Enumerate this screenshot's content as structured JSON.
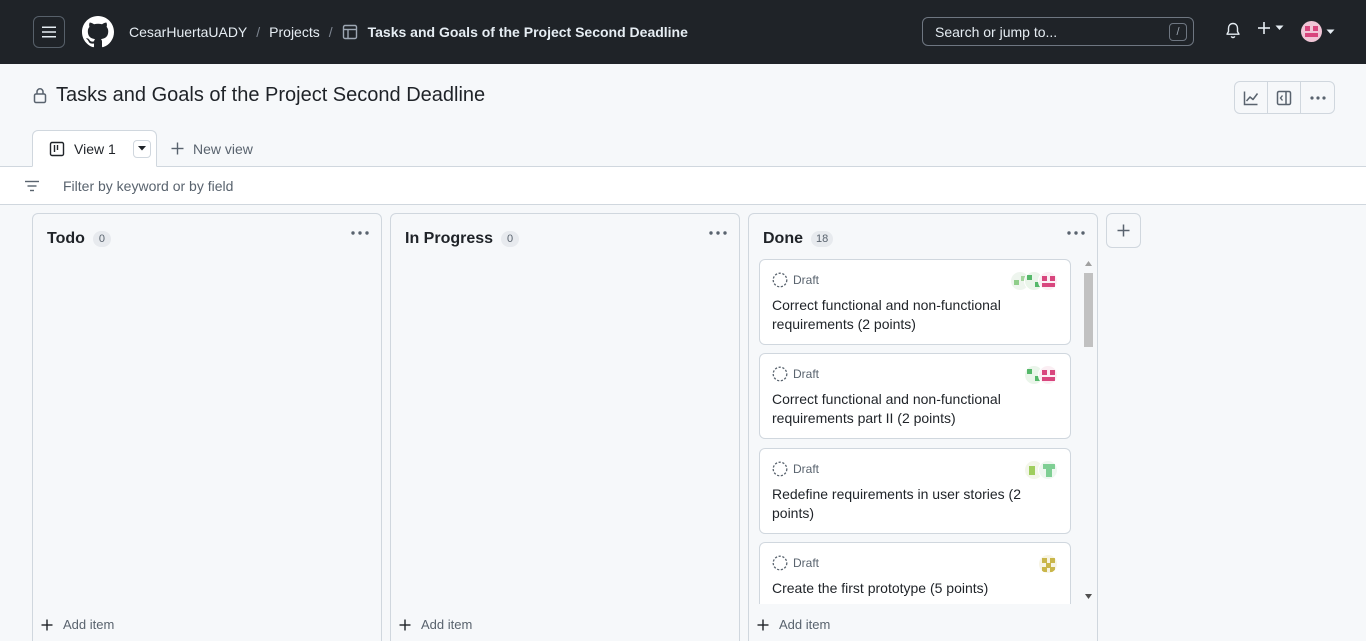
{
  "header": {
    "owner": "CesarHuertaUADY",
    "projects": "Projects",
    "project_name": "Tasks and Goals of the Project Second Deadline",
    "search_placeholder": "Search or jump to...",
    "search_shortcut": "/"
  },
  "project": {
    "title": "Tasks and Goals of the Project Second Deadline",
    "view_tab": "View 1",
    "new_view": "New view",
    "filter_placeholder": "Filter by keyword or by field"
  },
  "columns": [
    {
      "title": "Todo",
      "count": "0",
      "add_item": "Add item"
    },
    {
      "title": "In Progress",
      "count": "0",
      "add_item": "Add item"
    },
    {
      "title": "Done",
      "count": "18",
      "add_item": "Add item"
    }
  ],
  "cards": [
    {
      "status": "Draft",
      "title": "Correct functional and non-functional requirements (2 points)"
    },
    {
      "status": "Draft",
      "title": "Correct functional and non-functional requirements part II (2 points)"
    },
    {
      "status": "Draft",
      "title": "Redefine requirements in user stories (2 points)"
    },
    {
      "status": "Draft",
      "title": "Create the first prototype (5 points)"
    }
  ],
  "icons": {
    "menu": "hamburger-icon",
    "logo": "github-logo",
    "bell": "bell-icon",
    "plus": "plus-icon",
    "lock": "lock-icon",
    "insights": "graph-icon",
    "sidepanel": "sidebar-expand-icon",
    "more": "kebab-horizontal-icon",
    "filter": "filter-icon",
    "board": "project-board-icon"
  },
  "colors": {
    "topbar": "#1f2328",
    "page_bg": "#f6f8fa",
    "border": "#d0d7de",
    "muted_text": "#59636e"
  }
}
